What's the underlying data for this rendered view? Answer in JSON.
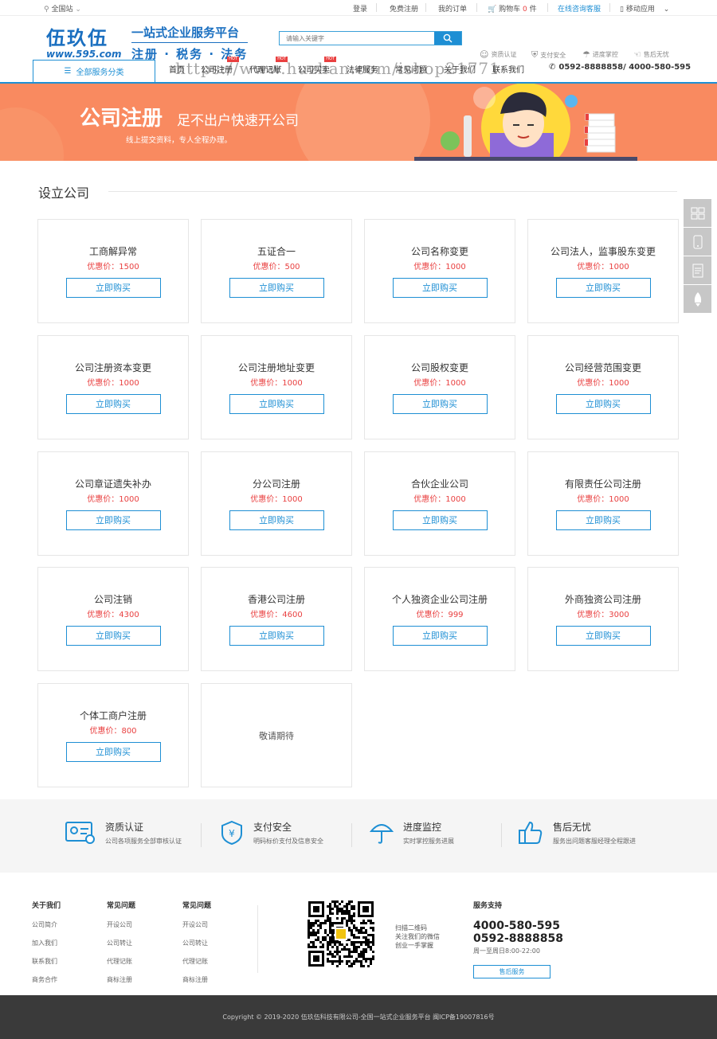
{
  "topbar": {
    "location": "全国站",
    "login": "登录",
    "register": "免费注册",
    "orders": "我的订单",
    "cart": "购物车",
    "cart_count": "0",
    "cart_unit": "件",
    "consult": "在线咨询客服",
    "mobile": "移动应用"
  },
  "header": {
    "logo_cn": "伍玖伍",
    "logo_url": "www.595.com",
    "slogan1": "一站式企业服务平台",
    "slogan2": "注册 · 税务 · 法务",
    "search_placeholder": "请输入关键字",
    "watermark": "https://www.huzhan.com/ishop21771",
    "assurances": [
      "资质认证",
      "支付安全",
      "进度掌控",
      "售后无忧"
    ]
  },
  "nav": {
    "all_categories": "全部服务分类",
    "items": [
      "首页",
      "公司注册",
      "代理记账",
      "公司买卖",
      "法律服务",
      "常见问题",
      "关于我们",
      "联系我们"
    ],
    "hot_label": "HOT",
    "phone": "0592-8888858/ 4000-580-595"
  },
  "banner": {
    "title": "公司注册",
    "subtitle": "足不出户快速开公司",
    "desc": "线上提交资料，专人全程办理。"
  },
  "section": {
    "title": "设立公司",
    "price_prefix": "优惠价：",
    "buy_label": "立即购买",
    "coming_soon": "敬请期待"
  },
  "products": [
    {
      "name": "工商解异常",
      "price": "1500"
    },
    {
      "name": "五证合一",
      "price": "500"
    },
    {
      "name": "公司名称变更",
      "price": "1000"
    },
    {
      "name": "公司法人，监事股东变更",
      "price": "1000"
    },
    {
      "name": "公司注册资本变更",
      "price": "1000"
    },
    {
      "name": "公司注册地址变更",
      "price": "1000"
    },
    {
      "name": "公司股权变更",
      "price": "1000"
    },
    {
      "name": "公司经营范围变更",
      "price": "1000"
    },
    {
      "name": "公司章证遗失补办",
      "price": "1000"
    },
    {
      "name": "分公司注册",
      "price": "1000"
    },
    {
      "name": "合伙企业公司",
      "price": "1000"
    },
    {
      "name": "有限责任公司注册",
      "price": "1000"
    },
    {
      "name": "公司注销",
      "price": "4300"
    },
    {
      "name": "香港公司注册",
      "price": "4600"
    },
    {
      "name": "个人独资企业公司注册",
      "price": "999"
    },
    {
      "name": "外商独资公司注册",
      "price": "3000"
    },
    {
      "name": "个体工商户注册",
      "price": "800"
    }
  ],
  "features": [
    {
      "title": "资质认证",
      "desc": "公司各项服务全部审核认证"
    },
    {
      "title": "支付安全",
      "desc": "明码标价支付及信息安全"
    },
    {
      "title": "进度监控",
      "desc": "实时掌控服务进展"
    },
    {
      "title": "售后无忧",
      "desc": "服务出问题客服经理全程跟进"
    }
  ],
  "footer": {
    "cols": [
      {
        "head": "关于我们",
        "items": [
          "公司简介",
          "加入我们",
          "联系我们",
          "商务合作"
        ]
      },
      {
        "head": "常见问题",
        "items": [
          "开设公司",
          "公司转让",
          "代理记账",
          "商标注册"
        ]
      },
      {
        "head": "常见问题",
        "items": [
          "开设公司",
          "公司转让",
          "代理记账",
          "商标注册"
        ]
      }
    ],
    "qr_text": [
      "扫描二维码",
      "关注我们的微信",
      "创业一手掌握"
    ],
    "support_head": "服务支持",
    "support_phone1": "4000-580-595",
    "support_phone2": "0592-8888858",
    "support_hours": "周一至周日8:00-22:00",
    "after_sale": "售后服务",
    "copyright": "Copyright © 2019-2020 伍玖伍科技有限公司-全国一站式企业服务平台 闽ICP备19007816号"
  },
  "colors": {
    "brand": "#1e8fd4",
    "banner": "#f98a60",
    "price": "#e94040",
    "footer": "#3a3a3a"
  }
}
